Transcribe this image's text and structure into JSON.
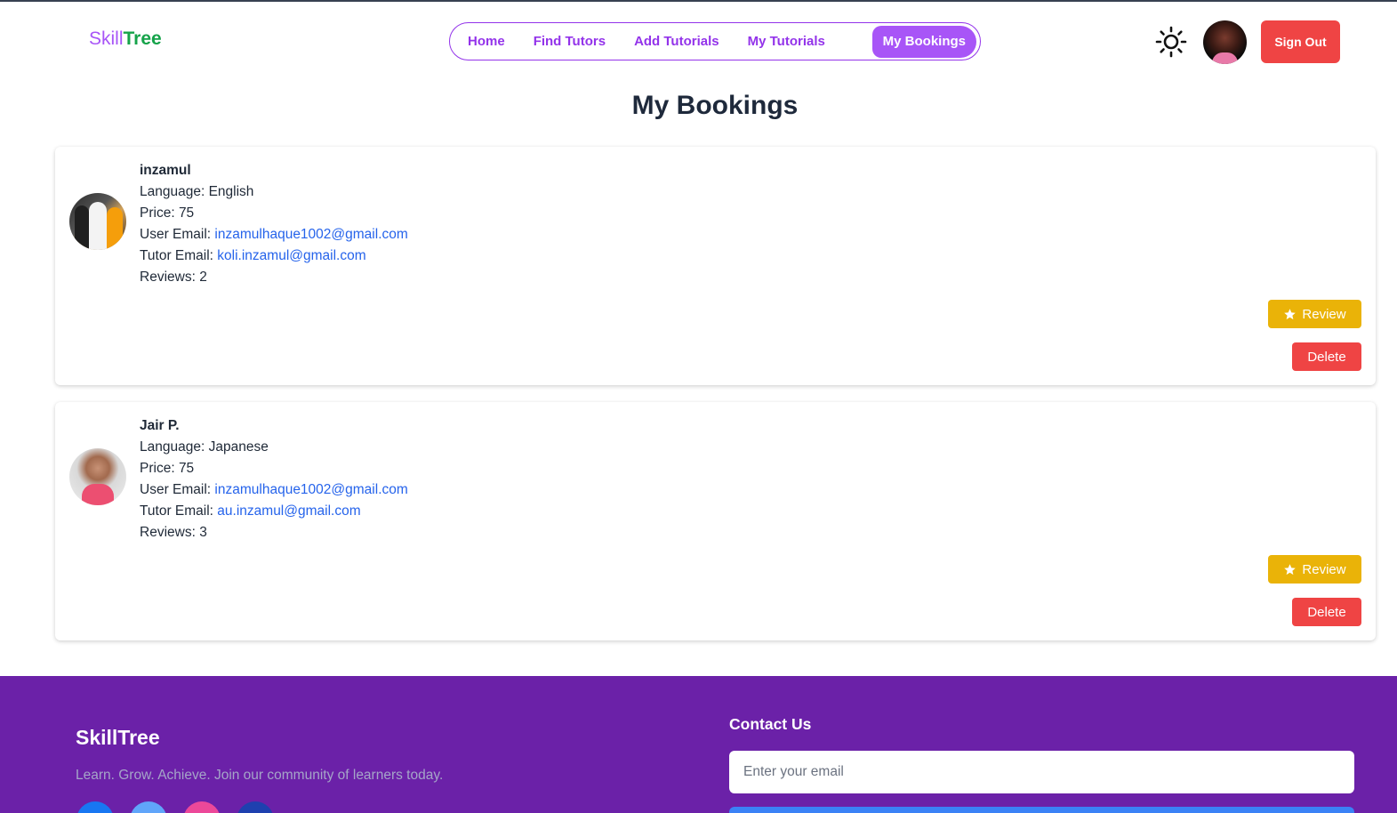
{
  "brand": {
    "part1": "Skill",
    "part2": "Tree"
  },
  "nav": {
    "items": [
      {
        "label": "Home",
        "active": false
      },
      {
        "label": "Find Tutors",
        "active": false
      },
      {
        "label": "Add Tutorials",
        "active": false
      },
      {
        "label": "My Tutorials",
        "active": false
      },
      {
        "label": "My Bookings",
        "active": true
      }
    ]
  },
  "header": {
    "theme_icon": "sun-icon",
    "signout_label": "Sign Out"
  },
  "page": {
    "title": "My Bookings"
  },
  "bookings": [
    {
      "name": "inzamul",
      "language_label": "Language:",
      "language": "English",
      "price_label": "Price:",
      "price": "75",
      "user_email_label": "User Email:",
      "user_email": "inzamulhaque1002@gmail.com",
      "tutor_email_label": "Tutor Email:",
      "tutor_email": "koli.inzamul@gmail.com",
      "reviews_label": "Reviews:",
      "reviews": "2",
      "review_button": "Review",
      "delete_button": "Delete"
    },
    {
      "name": "Jair P.",
      "language_label": "Language:",
      "language": "Japanese",
      "price_label": "Price:",
      "price": "75",
      "user_email_label": "User Email:",
      "user_email": "inzamulhaque1002@gmail.com",
      "tutor_email_label": "Tutor Email:",
      "tutor_email": "au.inzamul@gmail.com",
      "reviews_label": "Reviews:",
      "reviews": "3",
      "review_button": "Review",
      "delete_button": "Delete"
    }
  ],
  "footer": {
    "brand": "SkillTree",
    "tagline": "Learn. Grow. Achieve. Join our community of learners today.",
    "contact_title": "Contact Us",
    "email_placeholder": "Enter your email",
    "social_colors": [
      "#1877f2",
      "#60a5fa",
      "#ec4899",
      "#1e40af"
    ]
  },
  "colors": {
    "accent": "#a855f7",
    "nav_text": "#9333ea",
    "danger": "#ef4444",
    "warning": "#eab308",
    "link": "#2563eb",
    "footer_bg": "#6b21a8"
  }
}
